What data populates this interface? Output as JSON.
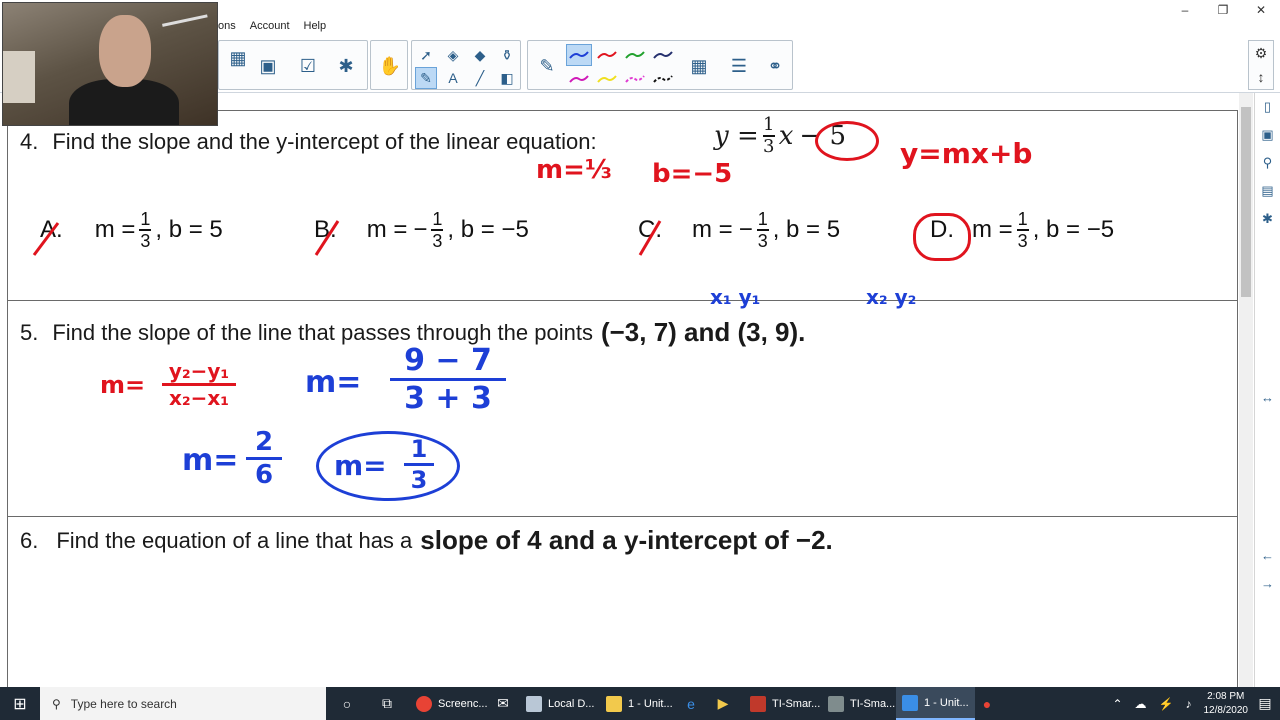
{
  "menus": [
    "ons",
    "Account",
    "Help"
  ],
  "window_controls": [
    "–",
    "❐",
    "✕"
  ],
  "questions": {
    "q4": {
      "number": "4.",
      "text": "Find the slope and the y-intercept of the linear equation:",
      "eq_y": "y =",
      "eq_num": "1",
      "eq_den": "3",
      "eq_x": "x",
      "eq_b": "− 5"
    },
    "q5": {
      "number": "5.",
      "text": "Find the slope of the line that passes through the points",
      "points": "(−3, 7) and (3, 9)."
    },
    "q6": {
      "number": "6.",
      "text": "Find the equation of a line that has a",
      "emph": "slope of 4 and a y-intercept of −2."
    }
  },
  "choices": [
    {
      "letter": "A.",
      "m_pre": "m =",
      "sign": "",
      "num": "1",
      "den": "3",
      "b": ", b = 5"
    },
    {
      "letter": "B.",
      "m_pre": "m =",
      "sign": "−",
      "num": "1",
      "den": "3",
      "b": ", b = −5"
    },
    {
      "letter": "C.",
      "m_pre": "m =",
      "sign": "−",
      "num": "1",
      "den": "3",
      "b": ", b = 5"
    },
    {
      "letter": "D.",
      "m_pre": "m =",
      "sign": "",
      "num": "1",
      "den": "3",
      "b": ", b = −5"
    }
  ],
  "annotations": {
    "ymxb": "y=mx+b",
    "m_eq": "m=⅓",
    "b_eq": "b=−5",
    "x1y1": "x₁ y₁",
    "x2y2": "x₂ y₂",
    "slope_formula_top": "y₂−y₁",
    "slope_formula_bot": "x₂−x₁",
    "m_label": "m=",
    "sub_top": "9 − 7",
    "sub_bot": "3 + 3",
    "m26": "m=",
    "m26_num": "2",
    "m26_den": "6",
    "ans": "m=",
    "ans_num": "1",
    "ans_den": "3"
  },
  "taskbar": {
    "search_placeholder": "Type here to search",
    "apps": [
      "Screenc...",
      "Local D...",
      "1 - Unit...",
      "TI-Smar...",
      "TI-Sma...",
      "1 - Unit..."
    ],
    "time": "2:08 PM",
    "date": "12/8/2020"
  },
  "colors": {
    "ink_red": "#e0141e",
    "ink_blue": "#1d3fd6",
    "selected": "#bcd9f5"
  }
}
